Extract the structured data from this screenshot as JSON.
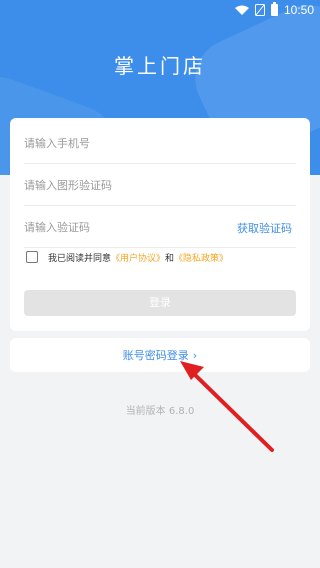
{
  "status": {
    "time": "10:50",
    "icons": [
      "wifi-icon",
      "no-sim-icon",
      "battery-icon"
    ]
  },
  "header": {
    "title": "掌上门店"
  },
  "form": {
    "phone_placeholder": "请输入手机号",
    "captcha_placeholder": "请输入图形验证码",
    "code_placeholder": "请输入验证码",
    "get_code_label": "获取验证码",
    "agree_prefix": "我已阅读并同意",
    "user_agreement": "《用户协议》",
    "and_text": "和",
    "privacy_policy": "《隐私政策》",
    "login_label": "登录"
  },
  "alt_login": {
    "label": "账号密码登录",
    "chevron": "›"
  },
  "footer": {
    "version": "当前版本 6.8.0"
  },
  "colors": {
    "primary": "#3d8eea",
    "link_orange": "#f5a623",
    "button_disabled": "#e3e3e3",
    "background": "#f2f3f5",
    "arrow": "#e02020"
  }
}
